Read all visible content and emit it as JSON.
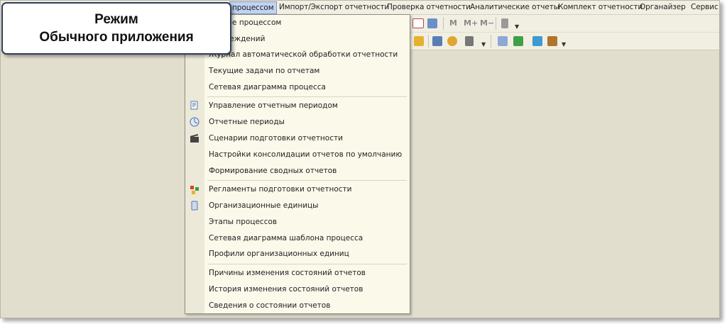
{
  "menubar": {
    "items": [
      {
        "label": "процессом"
      },
      {
        "label": "Импорт/Экспорт отчетности"
      },
      {
        "label": "Проверка отчетности"
      },
      {
        "label": "Аналитические отчеты"
      },
      {
        "label": "Комплект отчетности"
      },
      {
        "label": "Органайзер"
      },
      {
        "label": "Сервис"
      }
    ]
  },
  "toolbar": {
    "memory_buttons": [
      "M",
      "M+",
      "M−"
    ]
  },
  "dropdown": {
    "groups": [
      [
        {
          "label": "вление процессом"
        },
        {
          "label": "и учреждений"
        },
        {
          "label": "Журнал автоматической обработки отчетности"
        },
        {
          "label": "Текущие задачи по отчетам"
        },
        {
          "label": "Сетевая диаграмма процесса"
        }
      ],
      [
        {
          "label": "Управление отчетным периодом",
          "icon": "period-management-icon"
        },
        {
          "label": "Отчетные периоды",
          "icon": "pie-clock-icon"
        },
        {
          "label": "Сценарии подготовки отчетности",
          "icon": "clapperboard-icon"
        },
        {
          "label": "Настройки консолидации отчетов по умолчанию"
        },
        {
          "label": "Формирование сводных отчетов"
        }
      ],
      [
        {
          "label": "Регламенты подготовки отчетности",
          "icon": "regulation-blocks-icon"
        },
        {
          "label": "Организационные единицы",
          "icon": "org-unit-icon"
        },
        {
          "label": "Этапы процессов"
        },
        {
          "label": "Сетевая диаграмма шаблона процесса"
        },
        {
          "label": "Профили организационных единиц"
        }
      ],
      [
        {
          "label": "Причины изменения состояний отчетов"
        },
        {
          "label": "История изменения состояний отчетов"
        },
        {
          "label": "Сведения о состоянии отчетов"
        }
      ]
    ]
  },
  "callout": {
    "line1": "Режим",
    "line2": "Обычного приложения"
  },
  "colors": {
    "workspace": "#e1dece",
    "menu_bg": "#fbf9ea",
    "highlight": "#c2d3f2",
    "callout_border": "#2f3d5c"
  }
}
